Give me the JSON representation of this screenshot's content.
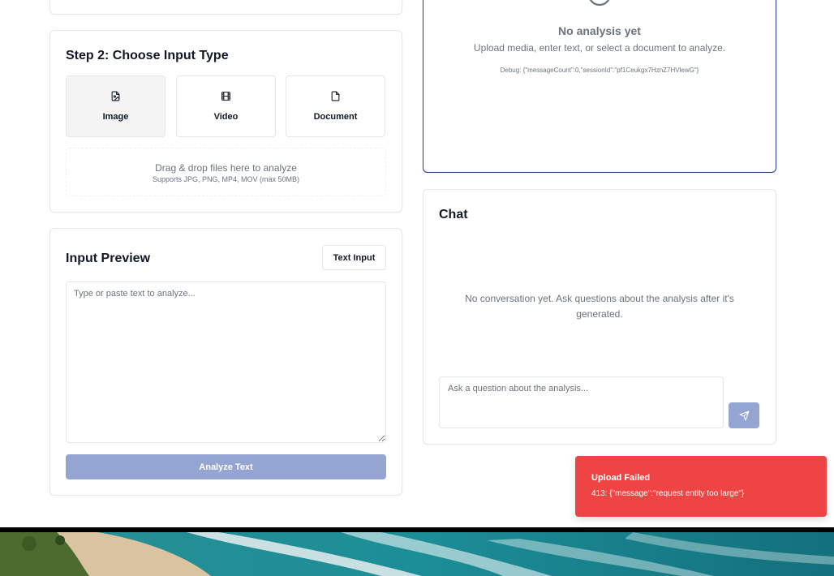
{
  "step2": {
    "title": "Step 2: Choose Input Type",
    "types": [
      {
        "label": "Image",
        "icon": "image-file-icon",
        "selected": true
      },
      {
        "label": "Video",
        "icon": "film-icon",
        "selected": false
      },
      {
        "label": "Document",
        "icon": "file-icon",
        "selected": false
      }
    ],
    "dropzone": {
      "main": "Drag & drop files here to analyze",
      "sub": "Supports JPG, PNG, MP4, MOV (max 50MB)"
    }
  },
  "preview": {
    "title": "Input Preview",
    "text_input_label": "Text Input",
    "textarea_placeholder": "Type or paste text to analyze...",
    "analyze_label": "Analyze Text"
  },
  "analysis": {
    "icon": "clock-icon",
    "title": "No analysis yet",
    "subtitle": "Upload media, enter text, or select a document to analyze.",
    "debug": "Debug: {\"messageCount\":0,\"sessionId\":\"pf1Ceukgx7HznZ7HVlewG\"}"
  },
  "chat": {
    "title": "Chat",
    "empty_message": "No conversation yet. Ask questions about the analysis after it's generated.",
    "input_placeholder": "Ask a question about the analysis...",
    "send_icon": "send-icon"
  },
  "toast": {
    "title": "Upload Failed",
    "message": "413: {\"message\":\"request entity too large\"}",
    "color": "#ef4444"
  },
  "colors": {
    "accent_disabled": "#93a5d0",
    "analysis_border": "#1e3a8a"
  }
}
